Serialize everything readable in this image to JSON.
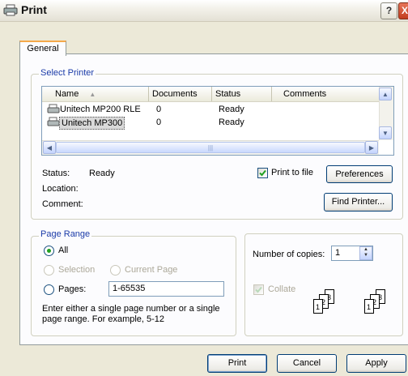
{
  "window": {
    "title": "Print",
    "help": "?",
    "close": "X"
  },
  "tabs": [
    {
      "label": "General"
    }
  ],
  "select_printer": {
    "legend": "Select Printer",
    "columns": [
      "Name",
      "Documents",
      "Status",
      "Comments"
    ],
    "rows": [
      {
        "name": "Unitech MP200 RLE",
        "documents": "0",
        "status": "Ready"
      },
      {
        "name": "Unitech MP300",
        "documents": "0",
        "status": "Ready",
        "selected": true
      }
    ],
    "status_label": "Status:",
    "status_value": "Ready",
    "location_label": "Location:",
    "comment_label": "Comment:",
    "print_to_file": "Print to file",
    "print_to_file_checked": true,
    "preferences": "Preferences",
    "find_printer": "Find Printer..."
  },
  "page_range": {
    "legend": "Page Range",
    "all": "All",
    "selection": "Selection",
    "current_page": "Current Page",
    "pages": "Pages:",
    "pages_value": "1-65535",
    "hint_line1": "Enter either a single page number or a single",
    "hint_line2": "page range.  For example, 5-12"
  },
  "copies": {
    "label": "Number of copies:",
    "value": "1",
    "collate": "Collate",
    "collate_checked": true,
    "stack_pages": [
      "1",
      "2",
      "3"
    ]
  },
  "footer": {
    "print": "Print",
    "cancel": "Cancel",
    "apply": "Apply"
  }
}
